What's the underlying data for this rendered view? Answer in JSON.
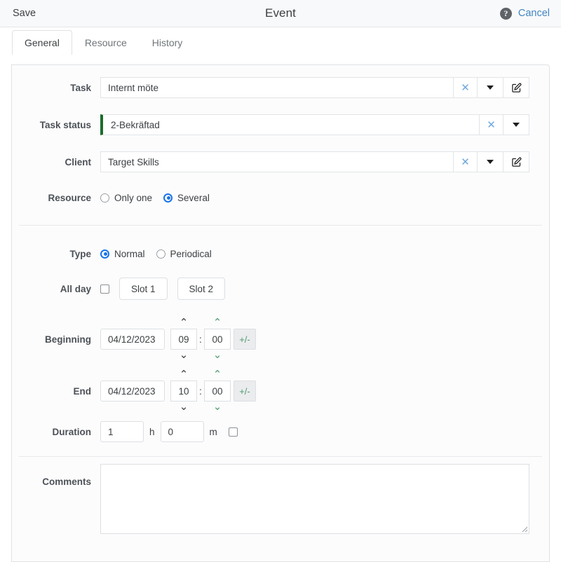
{
  "topbar": {
    "save_label": "Save",
    "title": "Event",
    "help_icon": "help-circle-icon",
    "cancel_label": "Cancel"
  },
  "tabs": [
    {
      "label": "General",
      "active": true
    },
    {
      "label": "Resource",
      "active": false
    },
    {
      "label": "History",
      "active": false
    }
  ],
  "form": {
    "task": {
      "label": "Task",
      "value": "Internt möte",
      "clear_icon": "clear-x-icon",
      "dropdown_icon": "chevron-down-icon",
      "edit_icon": "edit-pencil-icon"
    },
    "task_status": {
      "label": "Task status",
      "value": "2-Bekräftad",
      "accent_color": "#1d6b2c",
      "clear_icon": "clear-x-icon",
      "dropdown_icon": "chevron-down-icon"
    },
    "client": {
      "label": "Client",
      "value": "Target Skills",
      "clear_icon": "clear-x-icon",
      "dropdown_icon": "chevron-down-icon",
      "edit_icon": "edit-pencil-icon"
    },
    "resource": {
      "label": "Resource",
      "options": [
        {
          "label": "Only one",
          "selected": false
        },
        {
          "label": "Several",
          "selected": true
        }
      ]
    },
    "type": {
      "label": "Type",
      "options": [
        {
          "label": "Normal",
          "selected": true
        },
        {
          "label": "Periodical",
          "selected": false
        }
      ]
    },
    "all_day": {
      "label": "All day",
      "checked": false,
      "slot1_label": "Slot 1",
      "slot2_label": "Slot 2"
    },
    "beginning": {
      "label": "Beginning",
      "date": "04/12/2023",
      "hour": "09",
      "minute": "00",
      "separator": ":",
      "plusminus_label": "+/-",
      "up_icon": "chevron-up-icon",
      "down_icon": "chevron-down-icon"
    },
    "end": {
      "label": "End",
      "date": "04/12/2023",
      "hour": "10",
      "minute": "00",
      "separator": ":",
      "plusminus_label": "+/-",
      "up_icon": "chevron-up-icon",
      "down_icon": "chevron-down-icon"
    },
    "duration": {
      "label": "Duration",
      "hours": "1",
      "hours_unit": "h",
      "minutes": "0",
      "minutes_unit": "m",
      "checked": false
    },
    "comments": {
      "label": "Comments",
      "value": "",
      "resize_icon": "resize-grip-icon"
    }
  },
  "colors": {
    "accent_blue": "#1a73e8",
    "link_blue": "#4285c5",
    "status_green": "#1d6b2c",
    "spinner_green": "#4e9a72",
    "clear_blue": "#6fa8dc"
  }
}
